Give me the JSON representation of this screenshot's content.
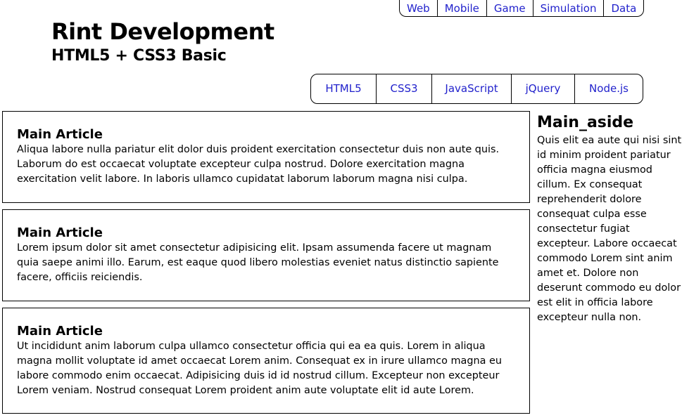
{
  "header": {
    "title": "Rint Development",
    "subtitle": "HTML5 + CSS3 Basic"
  },
  "top_nav": [
    "Web",
    "Mobile",
    "Game",
    "Simulation",
    "Data"
  ],
  "main_nav": [
    "HTML5",
    "CSS3",
    "JavaScript",
    "jQuery",
    "Node.js"
  ],
  "articles": [
    {
      "title": "Main Article",
      "body": "Aliqua labore nulla pariatur elit dolor duis proident exercitation consectetur duis non aute quis. Laborum do est occaecat voluptate excepteur culpa nostrud. Dolore exercitation magna exercitation velit labore. In laboris ullamco cupidatat laborum laborum magna nisi culpa."
    },
    {
      "title": "Main Article",
      "body": "Lorem ipsum dolor sit amet consectetur adipisicing elit. Ipsam assumenda facere ut magnam quia saepe animi illo. Earum, est eaque quod libero molestias eveniet natus distinctio sapiente facere, officiis reiciendis."
    },
    {
      "title": "Main Article",
      "body": "Ut incididunt anim laborum culpa ullamco consectetur officia qui ea ea quis. Lorem in aliqua magna mollit voluptate id amet occaecat Lorem anim. Consequat ex in irure ullamco magna eu labore commodo enim occaecat. Adipisicing duis id id nostrud cillum. Excepteur non excepteur Lorem veniam. Nostrud consequat Lorem proident anim aute voluptate elit id aute Lorem."
    }
  ],
  "aside": {
    "title": "Main_aside",
    "body": "Quis elit ea aute qui nisi sint id minim proident pariatur officia magna eiusmod cillum. Ex consequat reprehenderit dolore consequat culpa esse consectetur fugiat excepteur. Labore occaecat commodo Lorem sint anim amet et. Dolore non deserunt commodo eu dolor est elit in officia labore excepteur nulla non."
  },
  "colors": {
    "link": "#2222cc",
    "border": "#000000",
    "background": "#ffffff"
  }
}
